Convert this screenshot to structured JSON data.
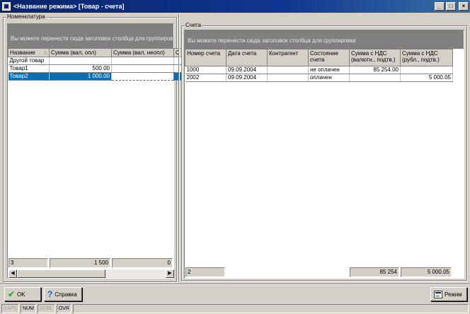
{
  "window": {
    "title": "<Название режима> [Товар - счета]",
    "minimize": "_",
    "maximize": "□",
    "close": "×"
  },
  "left_group": {
    "legend": "Номенклатура",
    "group_hint": "Вы можете перенести сюда заголовок столбца для группировки",
    "columns": [
      "Название",
      "Сумма (вал, опл)",
      "Сумма (вал, неопл)",
      "С"
    ],
    "rows": [
      {
        "name": "Другой товар",
        "paid": "",
        "unpaid": "",
        "extra": ""
      },
      {
        "name": "Товар1",
        "paid": "500.00",
        "unpaid": "",
        "extra": ""
      },
      {
        "name": "Товар2",
        "paid": "1 000.00",
        "unpaid": "",
        "extra": ""
      }
    ],
    "selected_row": 2,
    "footer": {
      "count": "3",
      "paid_total": "1 500",
      "unpaid_total": "0"
    }
  },
  "right_group": {
    "legend": "Счета",
    "group_hint": "Вы можете перенести сюда заголовок столбца для группировки",
    "columns": [
      "Номер счета",
      "Дата счета",
      "Контрагент",
      "Состояние счета",
      "Сумма с НДС (валютн., подтв.)",
      "Сумма с НДС (рубл., подтв.)"
    ],
    "rows": [
      {
        "number": "1000",
        "date": "09.09.2004",
        "counterparty": "",
        "state": "не оплачен",
        "sum_cur": "85 254.00",
        "sum_rub": ""
      },
      {
        "number": "2002",
        "date": "09.09.2004",
        "counterparty": "",
        "state": "оплачен",
        "sum_cur": "",
        "sum_rub": "5 000.05"
      }
    ],
    "footer": {
      "count": "2",
      "sum_cur_total": "85 254",
      "sum_rub_total": "5 000.05"
    }
  },
  "buttons": {
    "ok": "OK",
    "help": "Справка",
    "mode": "Режим"
  },
  "statusbar": [
    "CAPS",
    "NUM",
    "SCRL",
    "OVR"
  ],
  "statusbar_active": [
    false,
    true,
    false,
    true
  ]
}
